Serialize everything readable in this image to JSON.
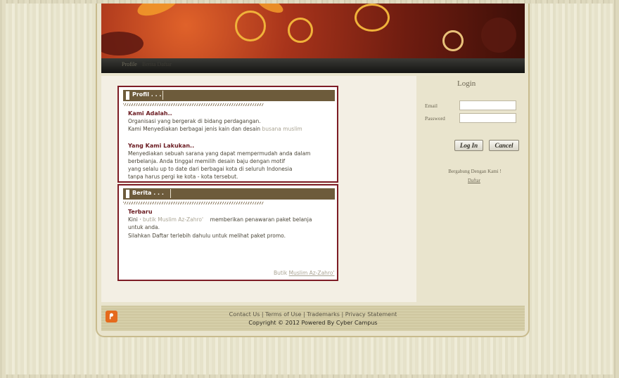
{
  "nav": {
    "active_link": "Profile",
    "faint_text": "Berita Daftar"
  },
  "profil": {
    "header": "Profil . . .",
    "section1_title": "Kami Adalah..",
    "section1_lines": [
      "Organisasi yang bergerak di bidang perdagangan.",
      "Kami Menyediakan berbagai jenis kain dan desain"
    ],
    "section1_faint": "busana muslim",
    "section2_title": "Yang Kami Lakukan..",
    "section2_lines": [
      "Menyediakan sebuah sarana yang dapat mempermudah anda dalam",
      "berbelanja. Anda tinggal memilih desain baju dengan motif",
      "yang selalu up to date dari berbagai kota di seluruh Indonesia",
      "tanpa harus pergi ke kota - kota tersebut."
    ]
  },
  "berita": {
    "header": "Berita . . .",
    "section_title": "Terbaru",
    "line1_pre": "Kini",
    "line1_faint": "butik Muslim Az-Zahro'",
    "line1_post": "memberikan penawaran paket belanja",
    "line2": "untuk anda.",
    "line3": "Silahkan Daftar terlebih dahulu untuk melihat paket promo.",
    "signature_pre": "Butik",
    "signature_link": "Muslim Az-Zahro'"
  },
  "login": {
    "title": "Login",
    "email_label": "Email",
    "password_label": "Password",
    "email_value": "",
    "password_value": "",
    "login_button": "Log In",
    "cancel_button": "Cancel",
    "join_text": "Bergabung Dengan Kami !",
    "daftar_link": "Daftar"
  },
  "footer": {
    "links": "Contact Us | Terms of Use | Trademarks | Privacy Statement",
    "copyright": "Copyright © 2012 Powered By Cyber Campus"
  },
  "colors": {
    "accent": "#7d1c25",
    "panel_header": "#6d5b3b",
    "rss": "#e56a1c"
  }
}
